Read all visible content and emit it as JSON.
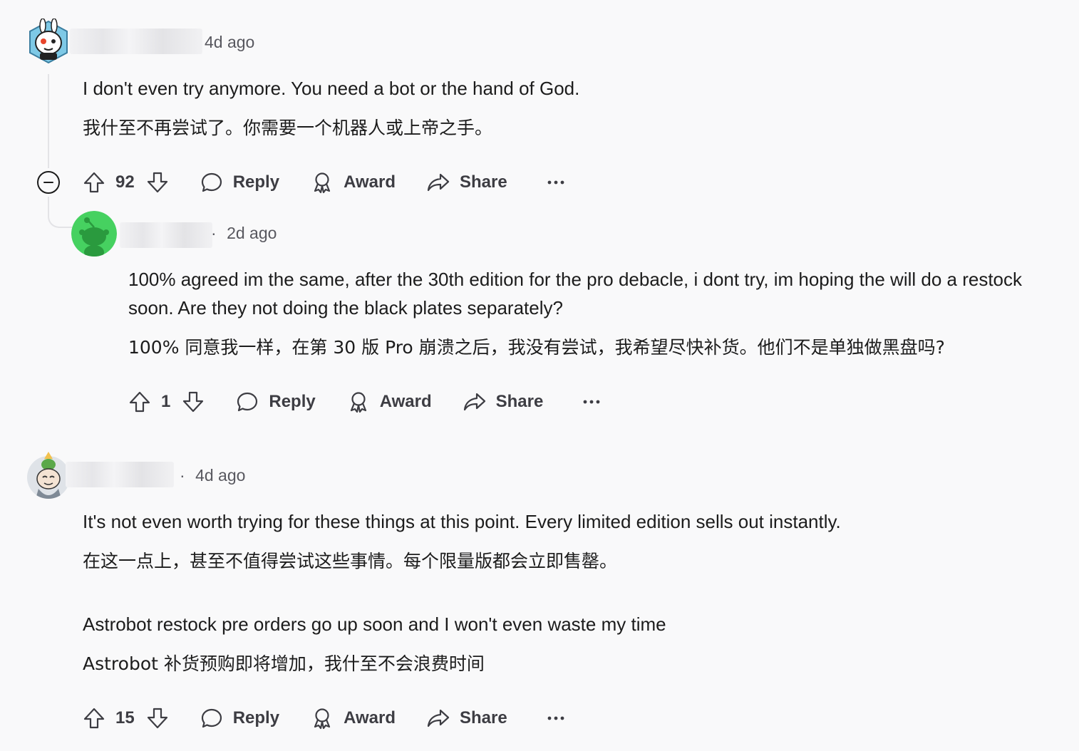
{
  "comments": [
    {
      "time": "4d ago",
      "body": [
        "I don't even try anymore. You need a bot or the hand of God.",
        "我什至不再尝试了。你需要一个机器人或上帝之手。"
      ],
      "votes": "92",
      "actions": {
        "reply": "Reply",
        "award": "Award",
        "share": "Share",
        "more": "···"
      }
    },
    {
      "time": "2d ago",
      "separator": "·",
      "body": [
        "100% agreed im the same, after the 30th edition for the pro debacle, i dont try, im hoping the will do a restock soon. Are they not doing the black plates separately?",
        "100% 同意我一样，在第 30 版 Pro 崩溃之后，我没有尝试，我希望尽快补货。他们不是单独做黑盘吗?"
      ],
      "votes": "1",
      "actions": {
        "reply": "Reply",
        "award": "Award",
        "share": "Share",
        "more": "···"
      }
    },
    {
      "time": "4d ago",
      "separator": "·",
      "body": [
        "It's not even worth trying for these things at this point. Every limited edition sells out instantly.",
        "在这一点上，甚至不值得尝试这些事情。每个限量版都会立即售罄。",
        "Astrobot restock pre orders go up soon and I won't even waste my time",
        "Astrobot 补货预购即将增加，我什至不会浪费时间"
      ],
      "votes": "15",
      "actions": {
        "reply": "Reply",
        "award": "Award",
        "share": "Share",
        "more": "···"
      }
    }
  ],
  "icons": {
    "upvote": "arrow-up-icon",
    "downvote": "arrow-down-icon",
    "reply": "speech-bubble-icon",
    "award": "award-ribbon-icon",
    "share": "share-arrow-icon",
    "collapse": "minus-circle-icon"
  },
  "colors": {
    "background": "#f9f9fa",
    "text": "#1c1c1c",
    "meta": "#58585f",
    "thread_line": "#e3e3e6",
    "avatar_green": "#46d160"
  }
}
